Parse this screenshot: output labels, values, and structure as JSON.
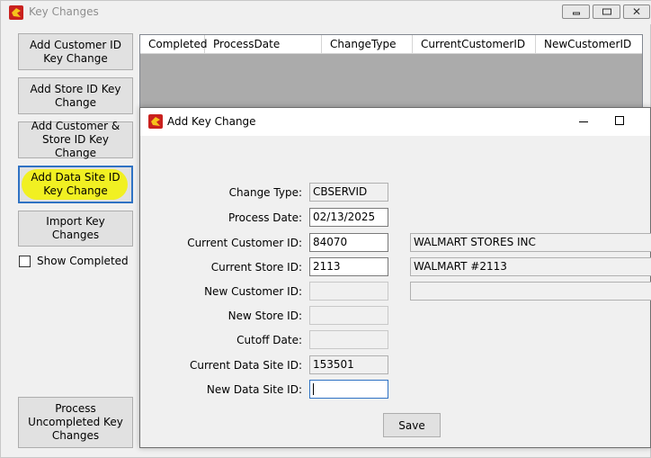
{
  "main_window": {
    "title": "Key Changes",
    "sidebar": {
      "buttons": [
        "Add Customer ID Key Change",
        "Add Store ID Key Change",
        "Add Customer & Store ID Key Change",
        "Add Data Site ID Key Change",
        "Import Key Changes"
      ],
      "show_completed_label": "Show Completed",
      "show_completed_checked": false,
      "process_button": "Process Uncompleted Key Changes"
    },
    "grid": {
      "columns": [
        "Completed",
        "ProcessDate",
        "ChangeType",
        "CurrentCustomerID",
        "NewCustomerID"
      ]
    }
  },
  "dialog": {
    "title": "Add Key Change",
    "fields": {
      "change_type": {
        "label": "Change Type:",
        "value": "CBSERVID"
      },
      "process_date": {
        "label": "Process Date:",
        "value": "02/13/2025"
      },
      "current_customer_id": {
        "label": "Current Customer ID:",
        "value": "84070",
        "name": "WALMART STORES INC"
      },
      "current_store_id": {
        "label": "Current Store ID:",
        "value": "2113",
        "name": "WALMART #2113"
      },
      "new_customer_id": {
        "label": "New Customer ID:",
        "value": "",
        "name": ""
      },
      "new_store_id": {
        "label": "New Store ID:",
        "value": ""
      },
      "cutoff_date": {
        "label": "Cutoff Date:",
        "value": ""
      },
      "current_data_site_id": {
        "label": "Current Data Site ID:",
        "value": "153501"
      },
      "new_data_site_id": {
        "label": "New Data Site ID:",
        "value": ""
      }
    },
    "save_label": "Save"
  },
  "colors": {
    "highlight": "#f3f20d",
    "focus_border": "#2f72c4",
    "grid_background": "#ababab"
  },
  "icons": {
    "app": "app-logo-icon",
    "minimize": "minimize-icon",
    "maximize": "maximize-icon",
    "close": "close-icon"
  }
}
